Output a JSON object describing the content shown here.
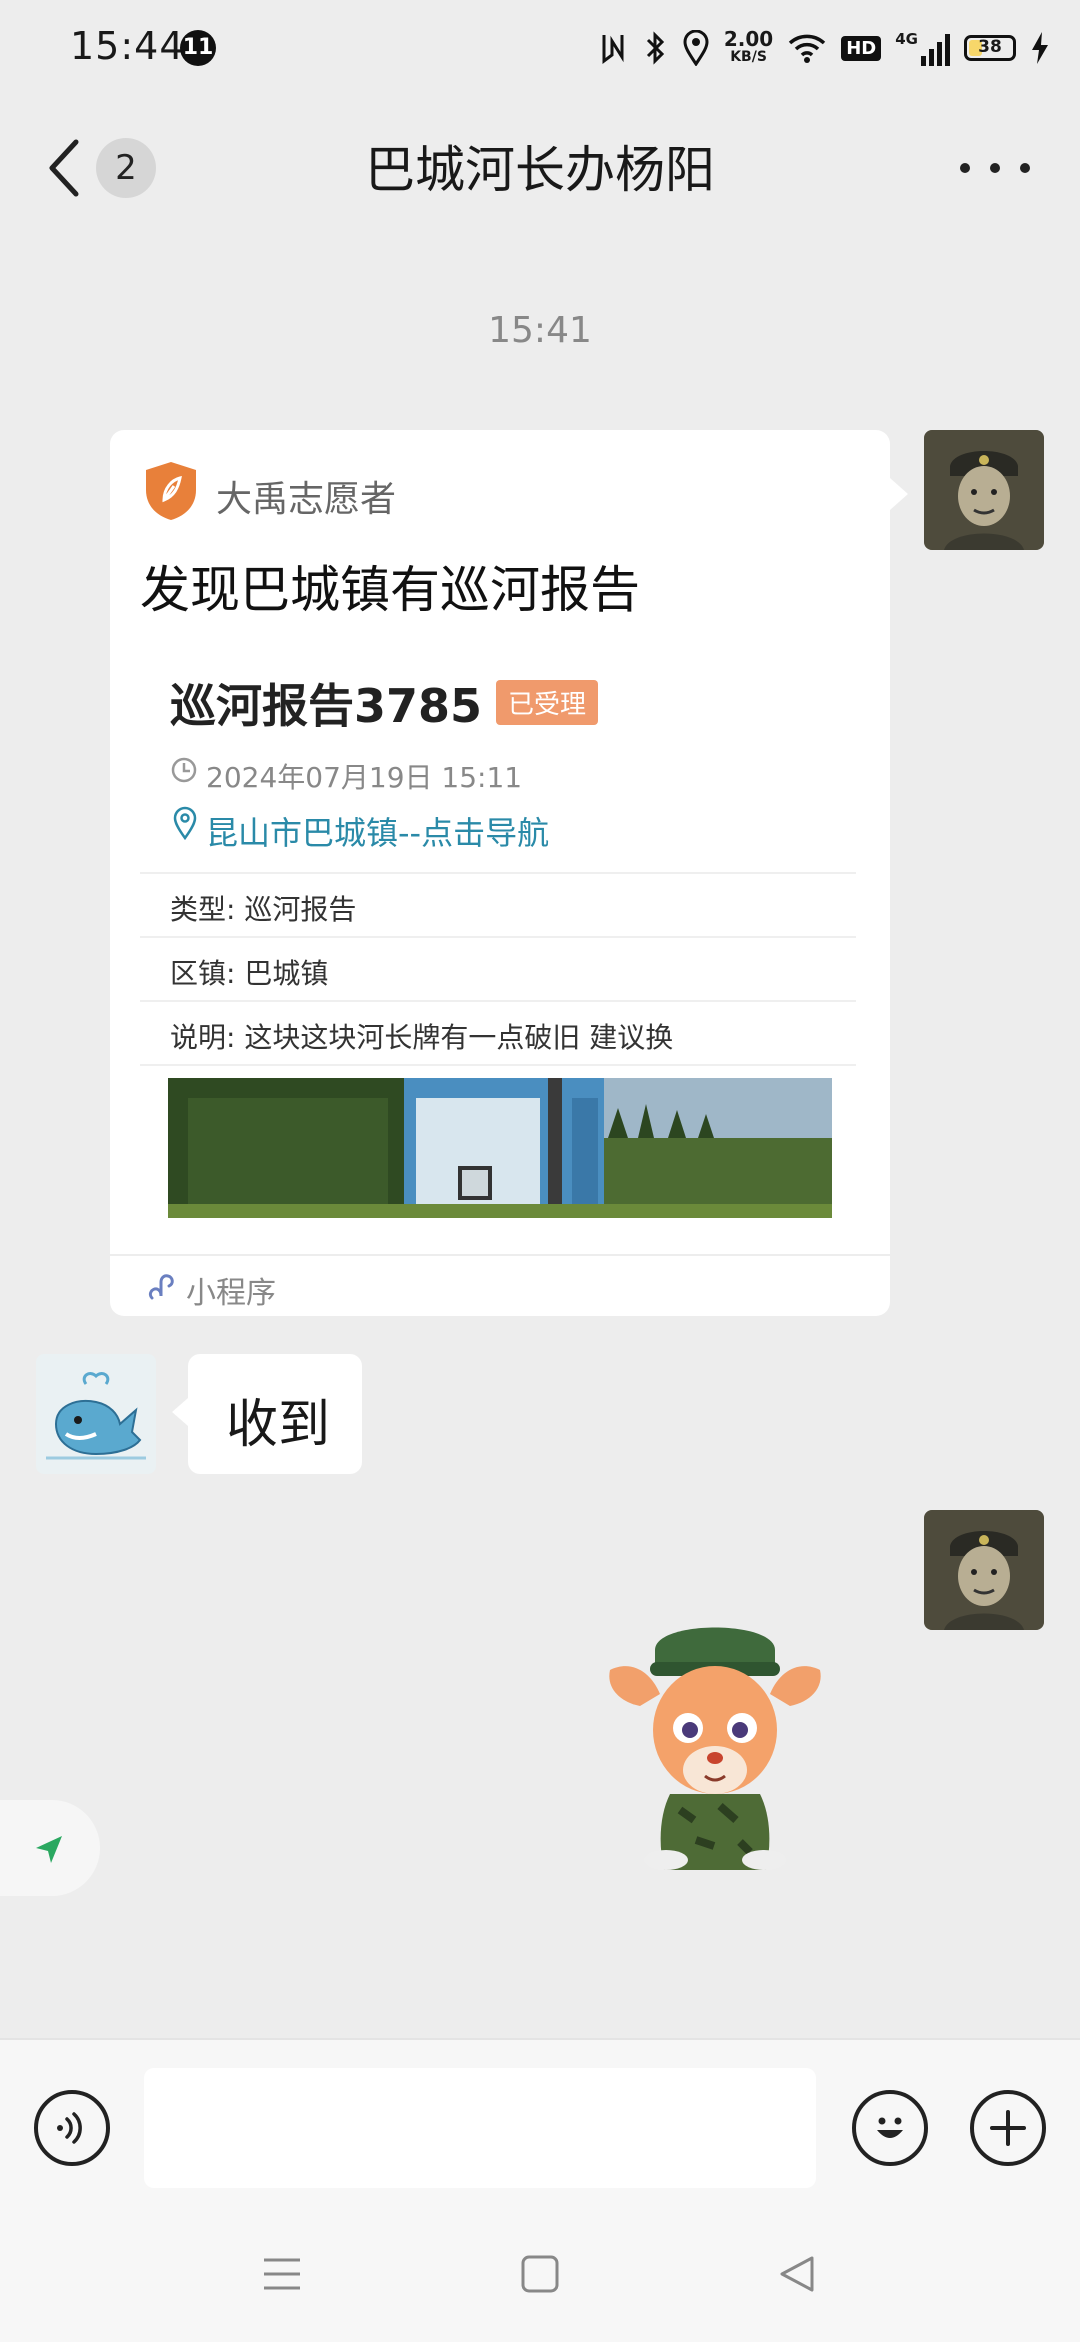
{
  "status_bar": {
    "time": "15:44",
    "notification_count": "11",
    "net_speed_value": "2.00",
    "net_speed_unit": "KB/S",
    "hd_label": "HD",
    "signal_label": "4G",
    "battery_level": "38"
  },
  "nav": {
    "unread_count": "2",
    "title": "巴城河长办杨阳",
    "icons": [
      "chevron-left-icon",
      "more-icon"
    ]
  },
  "chat": {
    "timestamp": "15:41",
    "mini_program_card": {
      "app_name": "大禹志愿者",
      "title": "发现巴城镇有巡河报告",
      "report_title": "巡河报告3785",
      "status": "已受理",
      "datetime": "2024年07月19日 15:11",
      "location": "昆山市巴城镇--点击导航",
      "rows": [
        {
          "label": "类型:",
          "value": "巡河报告"
        },
        {
          "label": "区镇:",
          "value": "巴城镇"
        },
        {
          "label": "说明:",
          "value": "这块这块河长牌有一点破旧 建议换"
        }
      ],
      "footer_label": "小程序",
      "accent_color": "#e8803a",
      "link_color": "#2a8aa8"
    },
    "received_message": "收到"
  },
  "input_bar": {
    "placeholder": "",
    "icons": [
      "voice-icon",
      "emoji-icon",
      "plus-icon"
    ]
  },
  "system_nav": {
    "icons": [
      "menu-icon",
      "home-icon",
      "back-icon"
    ]
  }
}
